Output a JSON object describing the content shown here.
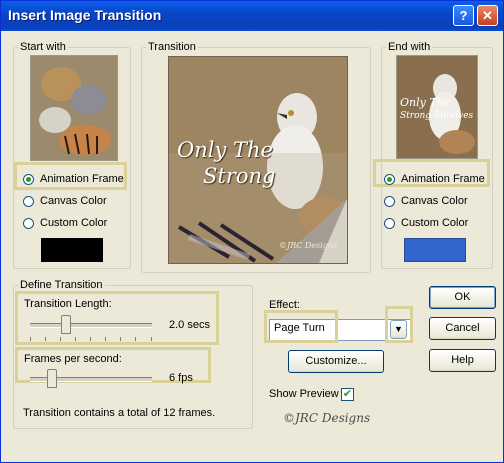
{
  "window": {
    "title": "Insert Image Transition",
    "help_glyph": "?",
    "close_glyph": "✕"
  },
  "start_with": {
    "legend": "Start with",
    "options": [
      "Animation Frame",
      "Canvas Color",
      "Custom Color"
    ],
    "selected": "Animation Frame",
    "custom_color": "#000000"
  },
  "transition": {
    "legend": "Transition",
    "preview_text_line1": "Only The",
    "preview_text_line2": "Strong",
    "preview_signature": "©JRC Designs"
  },
  "end_with": {
    "legend": "End with",
    "preview_text_line1": "Only The",
    "preview_text_line2": "Strong Survives",
    "options": [
      "Animation Frame",
      "Canvas Color",
      "Custom Color"
    ],
    "selected": "Animation Frame",
    "custom_color": "#3366cc"
  },
  "define": {
    "legend": "Define Transition",
    "length_label": "Transition Length:",
    "length_value": "2.0 secs",
    "length_fraction": 0.28,
    "fps_label": "Frames per second:",
    "fps_value": "6 fps",
    "fps_fraction": 0.15,
    "summary": "Transition contains a total of 12 frames."
  },
  "effect": {
    "label": "Effect:",
    "value": "Page Turn",
    "customize_label": "Customize...",
    "show_preview_label": "Show Preview",
    "show_preview_checked": true,
    "check_glyph": "✔",
    "dropdown_glyph": "▼"
  },
  "buttons": {
    "ok": "OK",
    "cancel": "Cancel",
    "help": "Help"
  },
  "watermark": "©JRC Designs",
  "colors": {
    "titlebar": "#0a49d0",
    "highlight": "#d9d09a",
    "dialog": "#ece9d8"
  }
}
